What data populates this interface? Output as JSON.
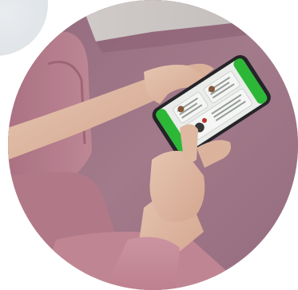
{
  "image": {
    "subject": "hands-holding-smartphone-photo",
    "colors": {
      "carpet": "#a4788a",
      "sofa": "#b9808f",
      "skin": "#e8c3ad",
      "screen_green": "#2fbf3a",
      "screen_white": "#f4f6f4",
      "phone_body": "#2a2a2e"
    }
  }
}
